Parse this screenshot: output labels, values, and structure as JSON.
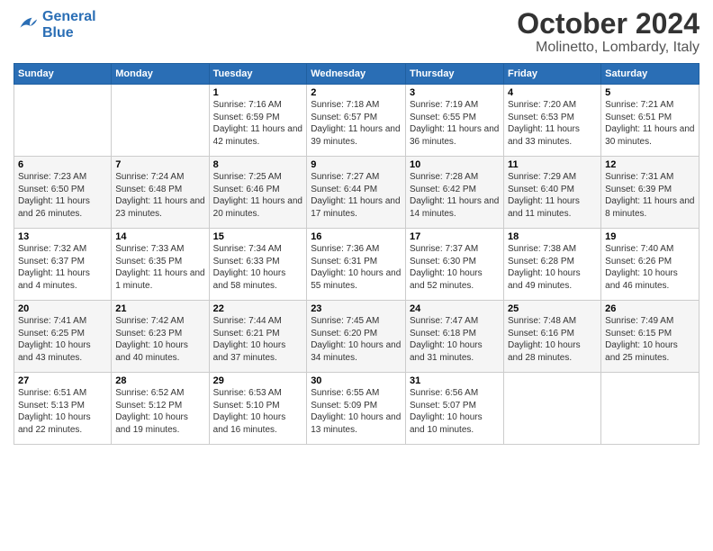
{
  "header": {
    "logo_line1": "General",
    "logo_line2": "Blue",
    "month_title": "October 2024",
    "location": "Molinetto, Lombardy, Italy"
  },
  "weekdays": [
    "Sunday",
    "Monday",
    "Tuesday",
    "Wednesday",
    "Thursday",
    "Friday",
    "Saturday"
  ],
  "weeks": [
    [
      {
        "day": "",
        "sunrise": "",
        "sunset": "",
        "daylight": ""
      },
      {
        "day": "",
        "sunrise": "",
        "sunset": "",
        "daylight": ""
      },
      {
        "day": "1",
        "sunrise": "Sunrise: 7:16 AM",
        "sunset": "Sunset: 6:59 PM",
        "daylight": "Daylight: 11 hours and 42 minutes."
      },
      {
        "day": "2",
        "sunrise": "Sunrise: 7:18 AM",
        "sunset": "Sunset: 6:57 PM",
        "daylight": "Daylight: 11 hours and 39 minutes."
      },
      {
        "day": "3",
        "sunrise": "Sunrise: 7:19 AM",
        "sunset": "Sunset: 6:55 PM",
        "daylight": "Daylight: 11 hours and 36 minutes."
      },
      {
        "day": "4",
        "sunrise": "Sunrise: 7:20 AM",
        "sunset": "Sunset: 6:53 PM",
        "daylight": "Daylight: 11 hours and 33 minutes."
      },
      {
        "day": "5",
        "sunrise": "Sunrise: 7:21 AM",
        "sunset": "Sunset: 6:51 PM",
        "daylight": "Daylight: 11 hours and 30 minutes."
      }
    ],
    [
      {
        "day": "6",
        "sunrise": "Sunrise: 7:23 AM",
        "sunset": "Sunset: 6:50 PM",
        "daylight": "Daylight: 11 hours and 26 minutes."
      },
      {
        "day": "7",
        "sunrise": "Sunrise: 7:24 AM",
        "sunset": "Sunset: 6:48 PM",
        "daylight": "Daylight: 11 hours and 23 minutes."
      },
      {
        "day": "8",
        "sunrise": "Sunrise: 7:25 AM",
        "sunset": "Sunset: 6:46 PM",
        "daylight": "Daylight: 11 hours and 20 minutes."
      },
      {
        "day": "9",
        "sunrise": "Sunrise: 7:27 AM",
        "sunset": "Sunset: 6:44 PM",
        "daylight": "Daylight: 11 hours and 17 minutes."
      },
      {
        "day": "10",
        "sunrise": "Sunrise: 7:28 AM",
        "sunset": "Sunset: 6:42 PM",
        "daylight": "Daylight: 11 hours and 14 minutes."
      },
      {
        "day": "11",
        "sunrise": "Sunrise: 7:29 AM",
        "sunset": "Sunset: 6:40 PM",
        "daylight": "Daylight: 11 hours and 11 minutes."
      },
      {
        "day": "12",
        "sunrise": "Sunrise: 7:31 AM",
        "sunset": "Sunset: 6:39 PM",
        "daylight": "Daylight: 11 hours and 8 minutes."
      }
    ],
    [
      {
        "day": "13",
        "sunrise": "Sunrise: 7:32 AM",
        "sunset": "Sunset: 6:37 PM",
        "daylight": "Daylight: 11 hours and 4 minutes."
      },
      {
        "day": "14",
        "sunrise": "Sunrise: 7:33 AM",
        "sunset": "Sunset: 6:35 PM",
        "daylight": "Daylight: 11 hours and 1 minute."
      },
      {
        "day": "15",
        "sunrise": "Sunrise: 7:34 AM",
        "sunset": "Sunset: 6:33 PM",
        "daylight": "Daylight: 10 hours and 58 minutes."
      },
      {
        "day": "16",
        "sunrise": "Sunrise: 7:36 AM",
        "sunset": "Sunset: 6:31 PM",
        "daylight": "Daylight: 10 hours and 55 minutes."
      },
      {
        "day": "17",
        "sunrise": "Sunrise: 7:37 AM",
        "sunset": "Sunset: 6:30 PM",
        "daylight": "Daylight: 10 hours and 52 minutes."
      },
      {
        "day": "18",
        "sunrise": "Sunrise: 7:38 AM",
        "sunset": "Sunset: 6:28 PM",
        "daylight": "Daylight: 10 hours and 49 minutes."
      },
      {
        "day": "19",
        "sunrise": "Sunrise: 7:40 AM",
        "sunset": "Sunset: 6:26 PM",
        "daylight": "Daylight: 10 hours and 46 minutes."
      }
    ],
    [
      {
        "day": "20",
        "sunrise": "Sunrise: 7:41 AM",
        "sunset": "Sunset: 6:25 PM",
        "daylight": "Daylight: 10 hours and 43 minutes."
      },
      {
        "day": "21",
        "sunrise": "Sunrise: 7:42 AM",
        "sunset": "Sunset: 6:23 PM",
        "daylight": "Daylight: 10 hours and 40 minutes."
      },
      {
        "day": "22",
        "sunrise": "Sunrise: 7:44 AM",
        "sunset": "Sunset: 6:21 PM",
        "daylight": "Daylight: 10 hours and 37 minutes."
      },
      {
        "day": "23",
        "sunrise": "Sunrise: 7:45 AM",
        "sunset": "Sunset: 6:20 PM",
        "daylight": "Daylight: 10 hours and 34 minutes."
      },
      {
        "day": "24",
        "sunrise": "Sunrise: 7:47 AM",
        "sunset": "Sunset: 6:18 PM",
        "daylight": "Daylight: 10 hours and 31 minutes."
      },
      {
        "day": "25",
        "sunrise": "Sunrise: 7:48 AM",
        "sunset": "Sunset: 6:16 PM",
        "daylight": "Daylight: 10 hours and 28 minutes."
      },
      {
        "day": "26",
        "sunrise": "Sunrise: 7:49 AM",
        "sunset": "Sunset: 6:15 PM",
        "daylight": "Daylight: 10 hours and 25 minutes."
      }
    ],
    [
      {
        "day": "27",
        "sunrise": "Sunrise: 6:51 AM",
        "sunset": "Sunset: 5:13 PM",
        "daylight": "Daylight: 10 hours and 22 minutes."
      },
      {
        "day": "28",
        "sunrise": "Sunrise: 6:52 AM",
        "sunset": "Sunset: 5:12 PM",
        "daylight": "Daylight: 10 hours and 19 minutes."
      },
      {
        "day": "29",
        "sunrise": "Sunrise: 6:53 AM",
        "sunset": "Sunset: 5:10 PM",
        "daylight": "Daylight: 10 hours and 16 minutes."
      },
      {
        "day": "30",
        "sunrise": "Sunrise: 6:55 AM",
        "sunset": "Sunset: 5:09 PM",
        "daylight": "Daylight: 10 hours and 13 minutes."
      },
      {
        "day": "31",
        "sunrise": "Sunrise: 6:56 AM",
        "sunset": "Sunset: 5:07 PM",
        "daylight": "Daylight: 10 hours and 10 minutes."
      },
      {
        "day": "",
        "sunrise": "",
        "sunset": "",
        "daylight": ""
      },
      {
        "day": "",
        "sunrise": "",
        "sunset": "",
        "daylight": ""
      }
    ]
  ]
}
